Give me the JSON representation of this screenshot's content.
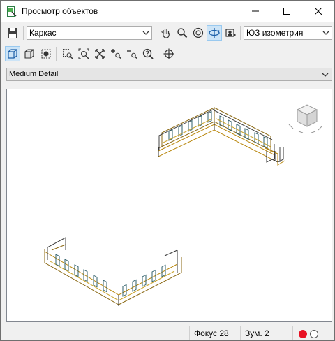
{
  "window": {
    "title": "Просмотр объектов"
  },
  "toolbar": {
    "visual_style": "Каркас",
    "view": "ЮЗ изометрия"
  },
  "detail_level": "Medium Detail",
  "status": {
    "focus": "Фокус 28",
    "zoom": "Зум. 2"
  },
  "colors": {
    "record": "#e81123",
    "accent": "#cce4f7"
  }
}
